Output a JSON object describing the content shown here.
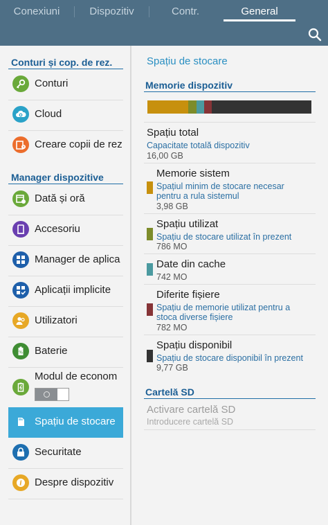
{
  "tabs": [
    {
      "label": "Conexiuni",
      "active": false
    },
    {
      "label": "Dispozitiv",
      "active": false
    },
    {
      "label": "Contr.",
      "active": false
    },
    {
      "label": "General",
      "active": true
    }
  ],
  "left": {
    "section1": "Conturi și cop. de rez.",
    "section2": "Manager dispozitive",
    "items": [
      {
        "label": "Conturi",
        "icon": "key-icon",
        "color": "#6aa93a"
      },
      {
        "label": "Cloud",
        "icon": "cloud-sync-icon",
        "color": "#2aa2c8"
      },
      {
        "label": "Creare copii de rez",
        "icon": "backup-icon",
        "color": "#ec6d2c"
      },
      {
        "label": "Dată și oră",
        "icon": "calendar-clock-icon",
        "color": "#6aa93a"
      },
      {
        "label": "Accesoriu",
        "icon": "device-accessory-icon",
        "color": "#6a3fb0"
      },
      {
        "label": "Manager de aplica",
        "icon": "apps-grid-icon",
        "color": "#1e5faa"
      },
      {
        "label": "Aplicații implicite",
        "icon": "default-apps-icon",
        "color": "#1e5faa"
      },
      {
        "label": "Utilizatori",
        "icon": "users-icon",
        "color": "#e7a826"
      },
      {
        "label": "Baterie",
        "icon": "battery-icon",
        "color": "#3f8d33"
      },
      {
        "label": "Modul de econom",
        "icon": "power-saving-icon",
        "color": "#6aa93a"
      },
      {
        "label": "Spațiu de stocare",
        "icon": "sd-card-icon",
        "color": "#3ba9d8"
      },
      {
        "label": "Securitate",
        "icon": "lock-icon",
        "color": "#1e6fb0"
      },
      {
        "label": "Despre dispozitiv",
        "icon": "info-icon",
        "color": "#e7a826"
      }
    ],
    "power_saving_toggle": "off"
  },
  "right": {
    "title": "Spațiu de stocare",
    "device_section": "Memorie dispozitiv",
    "storage_bar": [
      {
        "name": "Memorie sistem",
        "fraction": 0.249,
        "color": "#c7900e"
      },
      {
        "name": "Spațiu utilizat",
        "fraction": 0.049,
        "color": "#7d8c2a"
      },
      {
        "name": "Date din cache",
        "fraction": 0.046,
        "color": "#4b9aa0"
      },
      {
        "name": "Diferite fișiere",
        "fraction": 0.048,
        "color": "#863437"
      },
      {
        "name": "Spațiu disponibil",
        "fraction": 0.608,
        "color": "#333333"
      }
    ],
    "total": {
      "title": "Spațiu total",
      "sub": "Capacitate totală dispozitiv",
      "value": "16,00 GB"
    },
    "rows": [
      {
        "title": "Memorie sistem",
        "sub1": "Spațiul minim de stocare necesar",
        "sub2": "pentru a rula sistemul",
        "value": "3,98 GB",
        "color": "#c7900e"
      },
      {
        "title": "Spațiu utilizat",
        "sub1": "Spațiu de stocare utilizat în prezent",
        "sub2": "",
        "value": "786 MO",
        "color": "#7d8c2a"
      },
      {
        "title": "Date din cache",
        "sub1": "",
        "sub2": "",
        "value": "742 MO",
        "color": "#4b9aa0"
      },
      {
        "title": "Diferite fișiere",
        "sub1": "Spațiu de memorie utilizat pentru a",
        "sub2": "stoca diverse fișiere",
        "value": "782 MO",
        "color": "#863437"
      },
      {
        "title": "Spațiu disponibil",
        "sub1": "Spațiu de stocare disponibil în prezent",
        "sub2": "",
        "value": "9,77 GB",
        "color": "#333333"
      }
    ],
    "sd_section": "Cartelă SD",
    "sd_title": "Activare cartelă SD",
    "sd_sub": "Introducere cartelă SD"
  }
}
